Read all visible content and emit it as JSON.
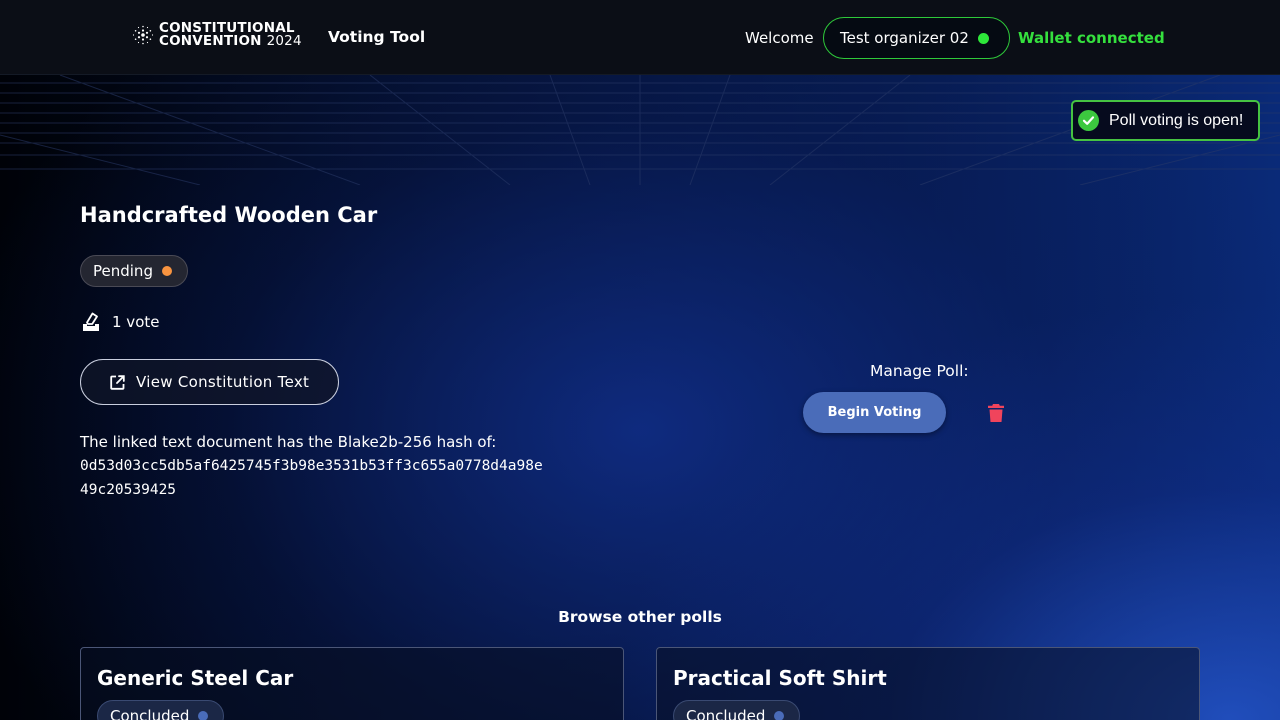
{
  "header": {
    "logo_line1": "CONSTITUTIONAL",
    "logo_line2": "CONVENTION",
    "logo_year": "2024",
    "nav_label": "Voting Tool",
    "welcome_label": "Welcome",
    "user_name": "Test organizer 02",
    "wallet_status": "Wallet connected"
  },
  "toast": {
    "message": "Poll voting is open!"
  },
  "poll": {
    "title": "Handcrafted Wooden Car",
    "status": "Pending",
    "votes_label": "1 vote",
    "view_button_label": "View Constitution Text",
    "hash_intro": "The linked text document has the Blake2b-256 hash of:",
    "hash_value": "0d53d03cc5db5af6425745f3b98e3531b53ff3c655a0778d4a98e49c20539425"
  },
  "manage": {
    "label": "Manage Poll:",
    "begin_button_label": "Begin Voting"
  },
  "browse": {
    "title": "Browse other polls",
    "polls": [
      {
        "title": "Generic Steel Car",
        "status": "Concluded"
      },
      {
        "title": "Practical Soft Shirt",
        "status": "Concluded"
      }
    ]
  },
  "colors": {
    "connected_green": "#35e03e",
    "pending_orange": "#f89440",
    "concluded_blue": "#4a6cb9",
    "delete_red": "#f0445c",
    "primary_button": "#4a6cb9"
  },
  "icons": {
    "logo": "cardano-logo-icon",
    "votes": "ballot-box-icon",
    "external_link": "external-link-icon",
    "toast": "check-circle-icon",
    "delete": "trash-icon"
  }
}
